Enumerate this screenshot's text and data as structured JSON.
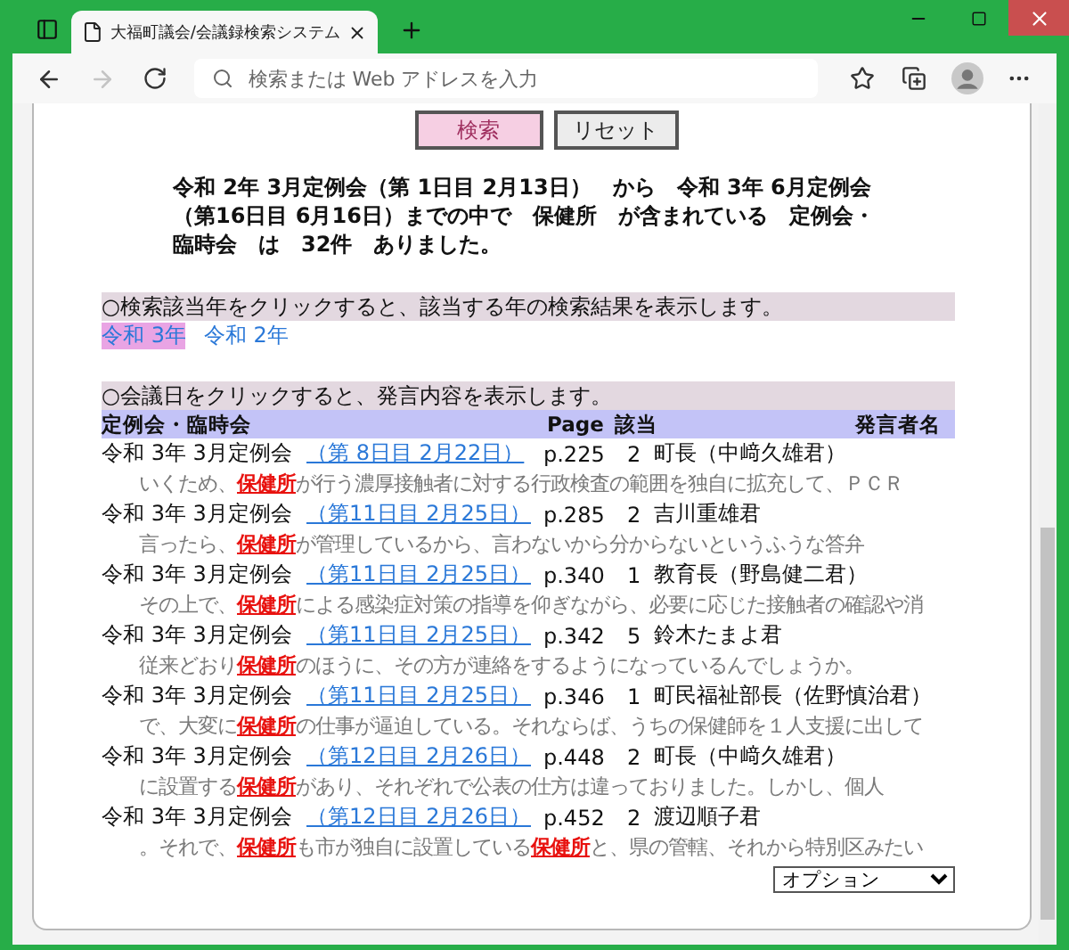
{
  "browser": {
    "tab_title": "大福町議会/会議録検索システム",
    "address_placeholder": "検索または Web アドレスを入力",
    "forward_disabled": true
  },
  "buttons": [
    {
      "label": "検索",
      "kind": "primary"
    },
    {
      "label": "リセット",
      "kind": "secondary"
    }
  ],
  "summary": "令和 2年 3月定例会（第 1日目 2月13日）　から　令和 3年 6月定例会（第16日目 6月16日）までの中で　保健所　が含まれている　定例会・臨時会　は　32件　ありました。",
  "year_section": {
    "instruction": "○検索該当年をクリックすると、該当する年の検索結果を表示します。",
    "years": [
      {
        "label": "令和 3年",
        "selected": true
      },
      {
        "label": "令和 2年",
        "selected": false
      }
    ]
  },
  "results_section": {
    "instruction": "○会議日をクリックすると、発言内容を表示します。",
    "columns": [
      "定例会・臨時会",
      "Page",
      "該当",
      "発言者名"
    ],
    "rows": [
      {
        "session": "令和 3年 3月定例会",
        "date": "（第 8日目 2月22日）",
        "page": "p.225",
        "hits": "2",
        "speaker": "町長（中﨑久雄君）",
        "snippet": [
          {
            "text": "いくため、",
            "hit": false
          },
          {
            "text": "保健所",
            "hit": true
          },
          {
            "text": "が行う濃厚接触者に対する行政検査の範囲を独自に拡充して、ＰＣＲ",
            "hit": false
          }
        ]
      },
      {
        "session": "令和 3年 3月定例会",
        "date": "（第11日目 2月25日）",
        "page": "p.285",
        "hits": "2",
        "speaker": "吉川重雄君",
        "snippet": [
          {
            "text": "言ったら、",
            "hit": false
          },
          {
            "text": "保健所",
            "hit": true
          },
          {
            "text": "が管理しているから、言わないから分からないというふうな答弁",
            "hit": false
          }
        ]
      },
      {
        "session": "令和 3年 3月定例会",
        "date": "（第11日目 2月25日）",
        "page": "p.340",
        "hits": "1",
        "speaker": "教育長（野島健二君）",
        "snippet": [
          {
            "text": "その上で、",
            "hit": false
          },
          {
            "text": "保健所",
            "hit": true
          },
          {
            "text": "による感染症対策の指導を仰ぎながら、必要に応じた接触者の確認や消",
            "hit": false
          }
        ]
      },
      {
        "session": "令和 3年 3月定例会",
        "date": "（第11日目 2月25日）",
        "page": "p.342",
        "hits": "5",
        "speaker": "鈴木たまよ君",
        "snippet": [
          {
            "text": "従来どおり",
            "hit": false
          },
          {
            "text": "保健所",
            "hit": true
          },
          {
            "text": "のほうに、その方が連絡をするようになっているんでしょうか。",
            "hit": false
          }
        ]
      },
      {
        "session": "令和 3年 3月定例会",
        "date": "（第11日目 2月25日）",
        "page": "p.346",
        "hits": "1",
        "speaker": "町民福祉部長（佐野慎治君）",
        "snippet": [
          {
            "text": "で、大変に",
            "hit": false
          },
          {
            "text": "保健所",
            "hit": true
          },
          {
            "text": "の仕事が逼迫している。それならば、うちの保健師を１人支援に出して",
            "hit": false
          }
        ]
      },
      {
        "session": "令和 3年 3月定例会",
        "date": "（第12日目 2月26日）",
        "page": "p.448",
        "hits": "2",
        "speaker": "町長（中﨑久雄君）",
        "snippet": [
          {
            "text": "に設置する",
            "hit": false
          },
          {
            "text": "保健所",
            "hit": true
          },
          {
            "text": "があり、それぞれで公表の仕方は違っておりました。しかし、個人",
            "hit": false
          }
        ]
      },
      {
        "session": "令和 3年 3月定例会",
        "date": "（第12日目 2月26日）",
        "page": "p.452",
        "hits": "2",
        "speaker": "渡辺順子君",
        "snippet": [
          {
            "text": "。それで、",
            "hit": false
          },
          {
            "text": "保健所",
            "hit": true
          },
          {
            "text": "も市が独自に設置している",
            "hit": false
          },
          {
            "text": "保健所",
            "hit": true
          },
          {
            "text": "と、県の管轄、それから特別区みたい",
            "hit": false
          }
        ]
      }
    ]
  },
  "options_select": {
    "value": "オプション"
  }
}
